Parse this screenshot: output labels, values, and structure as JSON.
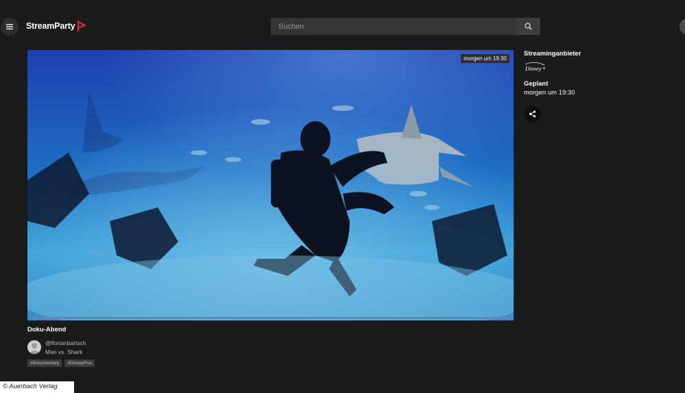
{
  "header": {
    "brand": "StreamParty",
    "search_placeholder": "Suchen"
  },
  "player": {
    "time_badge": "morgen um 19:30",
    "progress": 1.0
  },
  "sidebar": {
    "provider_label": "Streaminganbieter",
    "provider_logo": "Disney+",
    "scheduled_label": "Geplant",
    "scheduled_value": "morgen um 19:30"
  },
  "event": {
    "title": "Doku-Abend",
    "author": "@florianbartsch",
    "subtitle": "Man vs. Shark",
    "tags": [
      "#Documentary",
      "#DisneyPlus"
    ]
  },
  "watermark": "© Auerbach Verlag",
  "icons": {
    "menu": "hamburger-icon",
    "search": "search-icon",
    "share": "share-icon",
    "avatar": "user-avatar"
  },
  "colors": {
    "background": "#1c1b1c",
    "brand_accent": "#d62c3a",
    "progress": "#5c8cad"
  }
}
